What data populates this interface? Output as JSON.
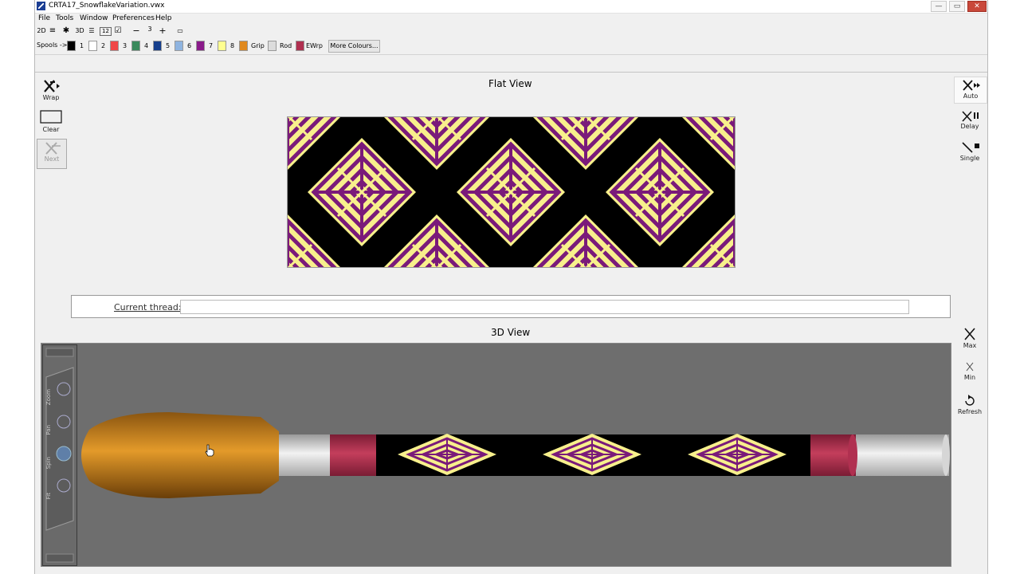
{
  "window": {
    "title": "CRTA17_SnowflakeVariation.vwx",
    "minimize_glyph": "—",
    "maximize_glyph": "▭",
    "close_glyph": "✕"
  },
  "menu": [
    "File",
    "Tools",
    "Window",
    "Preferences",
    "Help"
  ],
  "toolbar": {
    "view_2d": "2D",
    "view_3d": "3D",
    "list_glyph": "≡",
    "tools_glyph": "✱",
    "doc_glyph": "☰",
    "num_glyph": "12",
    "check_glyph": "☑",
    "minus": "−",
    "count": "3",
    "plus": "+",
    "ruler_glyph": "▭"
  },
  "spools": {
    "label": "Spools ->",
    "items": [
      {
        "num": "1",
        "color": "#000000"
      },
      {
        "num": "2",
        "color": "#ffffff"
      },
      {
        "num": "3",
        "color": "#f04848"
      },
      {
        "num": "4",
        "color": "#3a8a5c"
      },
      {
        "num": "5",
        "color": "#153e8c"
      },
      {
        "num": "6",
        "color": "#8fb4e0"
      },
      {
        "num": "7",
        "color": "#8a1a8a"
      },
      {
        "num": "8",
        "color": "#ffff90"
      }
    ],
    "grip": {
      "label": "Grip",
      "color": "#e08a20"
    },
    "rod": {
      "label": "Rod",
      "color": "#dcdcdc"
    },
    "ewrp": {
      "label": "EWrp",
      "color": "#b03050"
    },
    "more_label": "More Colours..."
  },
  "left_tools": {
    "wrap": "Wrap",
    "clear": "Clear",
    "next": "Next"
  },
  "right_tools": {
    "auto": "Auto",
    "delay": "Delay",
    "single": "Single",
    "max": "Max",
    "min": "Min",
    "refresh": "Refresh"
  },
  "flat_view": {
    "title": "Flat View",
    "colors": {
      "background": "#000000",
      "motif_light": "#f8f08c",
      "motif_dark": "#7a1a7a"
    }
  },
  "thread": {
    "label": "Current thread:",
    "value": ""
  },
  "view_3d": {
    "title": "3D View",
    "controls": [
      "Zoom",
      "Pan",
      "Spin",
      "Fit"
    ],
    "colors": {
      "background": "#6e6e6e",
      "grip": "#d08a20",
      "rod": "#dcdcdc",
      "ewrp": "#b03050"
    }
  }
}
